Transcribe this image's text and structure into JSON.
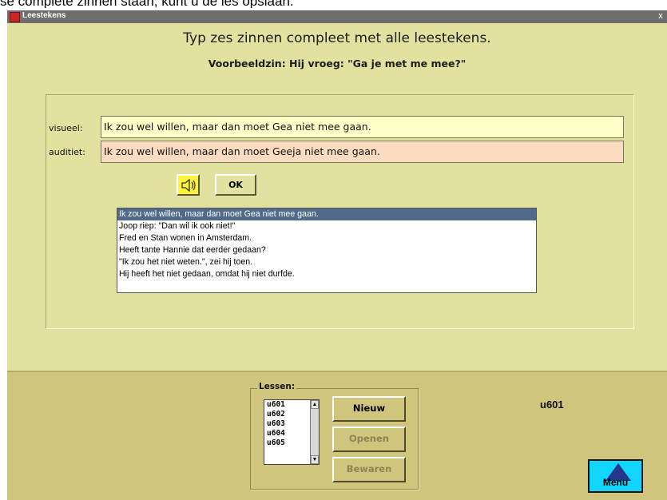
{
  "top_text": "se complete zinnen staan, kunt u de les opslaan.",
  "window": {
    "title": "Leestekens",
    "close_symbol": "x"
  },
  "exercise": {
    "heading": "Typ zes zinnen compleet met alle leestekens.",
    "example": "Voorbeeldzin: Hij vroeg: \"Ga je met me mee?\"",
    "visual_label": "visueel:",
    "visual_value": "Ik zou wel willen, maar dan moet Gea niet mee gaan.",
    "audio_label": "auditiet:",
    "audio_value": "Ik zou wel willen, maar dan moet Geeja niet mee gaan.",
    "ok_label": "OK",
    "sentences": [
      "Ik zou wel willen, maar dan moet Gea niet mee gaan.",
      "Joop riep: \"Dan wil ik ook niet!\"",
      "Fred en Stan wonen in Amsterdam.",
      "Heeft tante Hannie dat eerder gedaan?",
      "\"Ik zou het niet weten.\", zei hij toen.",
      "Hij heeft het niet gedaan, omdat hij niet durfde."
    ]
  },
  "lessons": {
    "legend": "Lessen:",
    "items": [
      "u601",
      "u602",
      "u603",
      "u604",
      "u605"
    ],
    "new_button": "Nieuw",
    "open_button": "Openen",
    "save_button": "Bewaren",
    "current_lesson": "u601"
  },
  "menu": {
    "label": "Menu"
  },
  "colors": {
    "window_bg": "#e3e1a0",
    "bottom_panel": "#cfc57c",
    "visual_field": "#ffffc8",
    "audio_field": "#fcdcc0",
    "speaker_button": "#fff23a",
    "selection": "#506a8a",
    "menu_button": "#11d4ff"
  }
}
